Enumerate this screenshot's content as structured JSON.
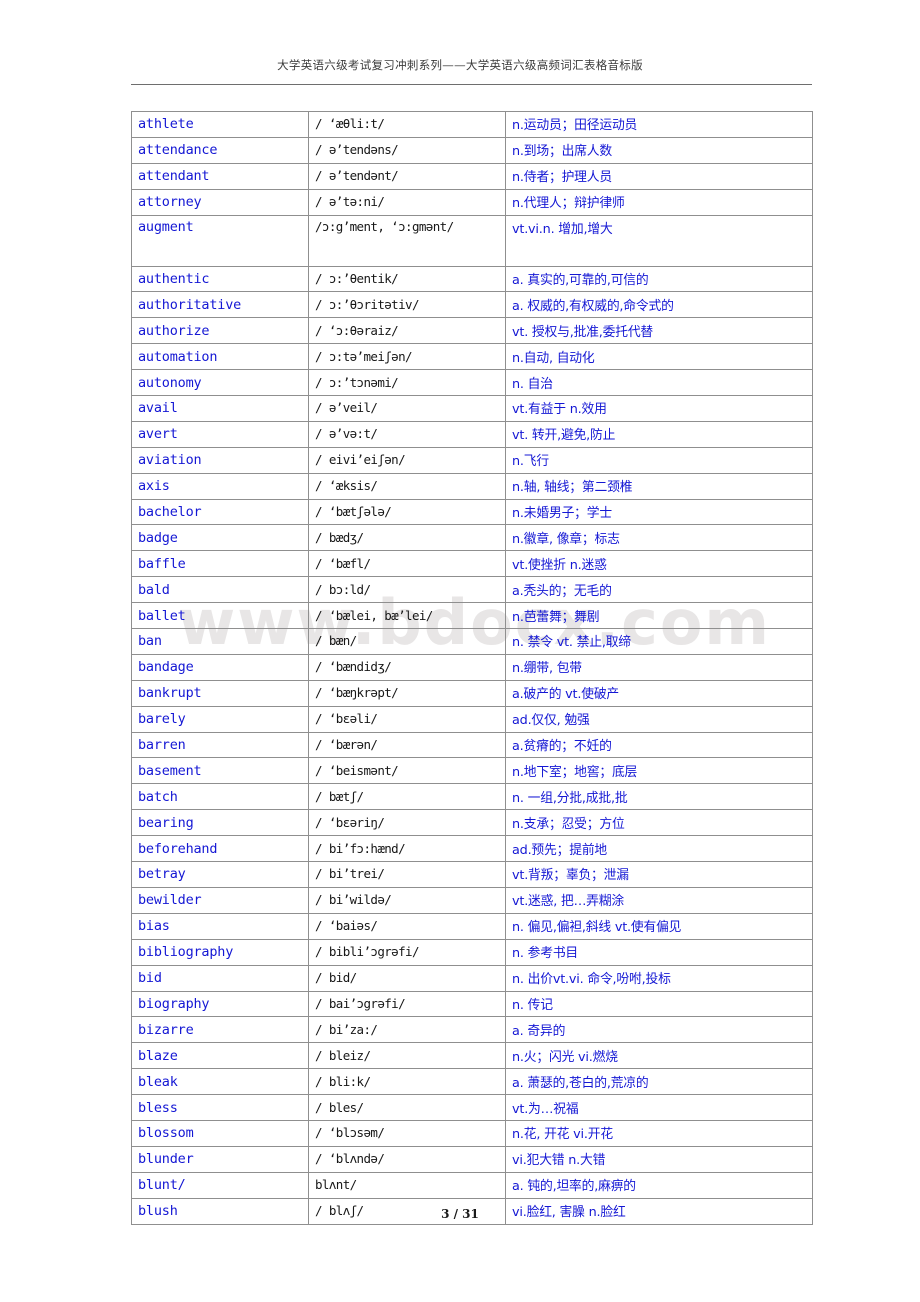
{
  "document": {
    "header_title": "大学英语六级考试复习冲刺系列——大学英语六级高频词汇表格音标版",
    "watermark": "www.bdocx.com",
    "page_number": "3 / 31",
    "word_color": "#1417d4",
    "phonetic_color": "#171717",
    "definition_color": "#1417d4",
    "rule_color": "#6e6e6e"
  },
  "table": {
    "columns": [
      "word",
      "phonetic",
      "definition"
    ],
    "rows": [
      {
        "word": "athlete",
        "phonetic": "/  ‘æθli:t/",
        "definition": "n.运动员；田径运动员"
      },
      {
        "word": "attendance",
        "phonetic": "/ ə’tendəns/",
        "definition": "n.到场；出席人数"
      },
      {
        "word": "attendant",
        "phonetic": "/ ə’tendənt/",
        "definition": "n.侍者；护理人员"
      },
      {
        "word": "attorney",
        "phonetic": "/ ə’tə:ni/",
        "definition": "n.代理人；辩护律师"
      },
      {
        "word": "augment",
        "phonetic": "/ɔ:g’ment, ‘ɔ:gmənt/",
        "definition": "vt.vi.n. 增加,增大",
        "tall": true
      },
      {
        "word": "authentic",
        "phonetic": "/ ɔ:’θentik/",
        "definition": "a. 真实的,可靠的,可信的"
      },
      {
        "word": "authoritative",
        "phonetic": "/ ɔ:’θɔritətiv/",
        "definition": "a. 权威的,有权威的,命令式的"
      },
      {
        "word": "authorize",
        "phonetic": "/ ‘ɔ:θəraiz/",
        "definition": "vt. 授权与,批准,委托代替"
      },
      {
        "word": "automation",
        "phonetic": "/ ɔ:tə’meiʃən/",
        "definition": "n.自动, 自动化"
      },
      {
        "word": "autonomy",
        "phonetic": "/ ɔ:’tɔnəmi/",
        "definition": "n. 自治"
      },
      {
        "word": "avail",
        "phonetic": "/ ə’veil/",
        "definition": "vt.有益于 n.效用"
      },
      {
        "word": "avert",
        "phonetic": "/ ə’və:t/",
        "definition": "vt. 转开,避免,防止"
      },
      {
        "word": "aviation",
        "phonetic": "/ eivi’eiʃən/",
        "definition": "n.飞行"
      },
      {
        "word": "axis",
        "phonetic": "/  ‘æksis/",
        "definition": "n.轴, 轴线；第二颈椎"
      },
      {
        "word": "bachelor",
        "phonetic": "/  ‘bætʃələ/",
        "definition": "n.未婚男子；学士"
      },
      {
        "word": "badge",
        "phonetic": "/ bædʒ/",
        "definition": "n.徽章, 像章；标志"
      },
      {
        "word": "baffle",
        "phonetic": "/  ‘bæfl/",
        "definition": "vt.使挫折 n.迷惑"
      },
      {
        "word": "bald",
        "phonetic": "/ bɔ:ld/",
        "definition": "a.秃头的；无毛的"
      },
      {
        "word": "ballet",
        "phonetic": "/  ‘bælei, bæ’lei/",
        "definition": "n.芭蕾舞；舞剧"
      },
      {
        "word": "ban",
        "phonetic": "/ bæn/",
        "definition": "n. 禁令 vt. 禁止,取缔"
      },
      {
        "word": "bandage",
        "phonetic": "/  ‘bændidʒ/",
        "definition": "n.绷带, 包带"
      },
      {
        "word": "bankrupt",
        "phonetic": "/  ‘bæŋkrəpt/",
        "definition": "a.破产的 vt.使破产"
      },
      {
        "word": "barely",
        "phonetic": "/  ‘bɛəli/",
        "definition": "ad.仅仅, 勉强"
      },
      {
        "word": "barren",
        "phonetic": "/  ‘bærən/",
        "definition": "a.贫瘠的；不妊的"
      },
      {
        "word": "basement",
        "phonetic": "/  ‘beismənt/",
        "definition": "n.地下室；地窖；底层"
      },
      {
        "word": "batch",
        "phonetic": "/ bætʃ/",
        "definition": "n. 一组,分批,成批,批"
      },
      {
        "word": "bearing",
        "phonetic": "/  ‘bɛəriŋ/",
        "definition": "n.支承；忍受；方位"
      },
      {
        "word": "beforehand",
        "phonetic": "/ bi’fɔ:hænd/",
        "definition": "ad.预先；提前地"
      },
      {
        "word": "betray",
        "phonetic": "/ bi’trei/",
        "definition": "vt.背叛；辜负；泄漏"
      },
      {
        "word": "bewilder",
        "phonetic": "/ bi’wildə/",
        "definition": "vt.迷惑, 把…弄糊涂"
      },
      {
        "word": "bias",
        "phonetic": "/  ‘baiəs/",
        "definition": "n. 偏见,偏袒,斜线 vt.使有偏见"
      },
      {
        "word": "bibliography",
        "phonetic": "/ bibli’ɔgrəfi/",
        "definition": "n. 参考书目"
      },
      {
        "word": "bid",
        "phonetic": "/ bid/",
        "definition": "n. 出价vt.vi. 命令,吩咐,投标"
      },
      {
        "word": "biography",
        "phonetic": "/ bai’ɔgrəfi/",
        "definition": "n. 传记"
      },
      {
        "word": "bizarre",
        "phonetic": "/ bi’za:/",
        "definition": "a. 奇异的"
      },
      {
        "word": "blaze",
        "phonetic": "/ bleiz/",
        "definition": "n.火；闪光 vi.燃烧"
      },
      {
        "word": "bleak",
        "phonetic": "/ bli:k/",
        "definition": "a. 萧瑟的,苍白的,荒凉的"
      },
      {
        "word": "bless",
        "phonetic": "/ bles/",
        "definition": "vt.为…祝福"
      },
      {
        "word": "blossom",
        "phonetic": "/  ‘blɔsəm/",
        "definition": "n.花, 开花 vi.开花"
      },
      {
        "word": "blunder",
        "phonetic": "/  ‘blʌndə/",
        "definition": "vi.犯大错 n.大错"
      },
      {
        "word": "blunt/",
        "phonetic": "blʌnt/",
        "definition": "a. 钝的,坦率的,麻痹的"
      },
      {
        "word": "blush",
        "phonetic": "/ blʌʃ/",
        "definition": "vi.脸红, 害臊 n.脸红"
      }
    ]
  }
}
